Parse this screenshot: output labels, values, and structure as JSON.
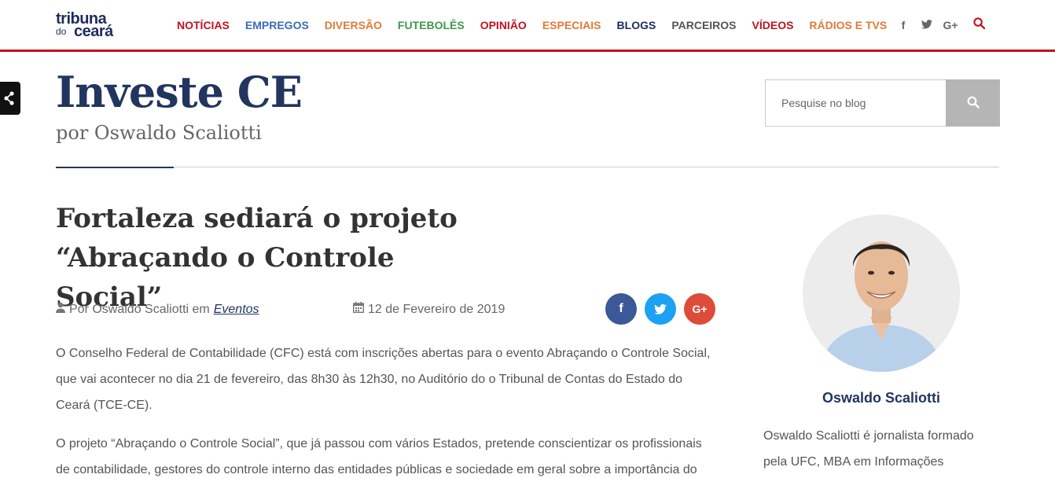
{
  "header": {
    "logo": {
      "line1": "tribuna",
      "line2": "do",
      "line3": "ceará"
    },
    "nav": [
      {
        "label": "NOTÍCIAS",
        "color": "#c1121f"
      },
      {
        "label": "EMPREGOS",
        "color": "#3a6cb5"
      },
      {
        "label": "DIVERSÃO",
        "color": "#e07b39"
      },
      {
        "label": "FUTEBOLÊS",
        "color": "#3c9a4a"
      },
      {
        "label": "OPINIÃO",
        "color": "#c1121f"
      },
      {
        "label": "ESPECIAIS",
        "color": "#e07b39"
      },
      {
        "label": "BLOGS",
        "color": "#1f2d5c"
      },
      {
        "label": "PARCEIROS",
        "color": "#555555"
      },
      {
        "label": "VÍDEOS",
        "color": "#c1121f"
      },
      {
        "label": "RÁDIOS E TVS",
        "color": "#e07b39"
      }
    ],
    "social": {
      "facebook": "f",
      "twitter": "twitter-icon",
      "gplus": "G+"
    }
  },
  "blog": {
    "title": "Investe CE",
    "subtitle": "por Oswaldo Scaliotti",
    "search_placeholder": "Pesquise no blog"
  },
  "post": {
    "title": "Fortaleza sediará o projeto “Abraçando o Controle Social”",
    "author_prefix": "Por Oswaldo Scaliotti em",
    "category": "Eventos",
    "date": "12 de Fevereiro de 2019",
    "share": {
      "facebook": "f",
      "gplus": "G+"
    },
    "paragraphs": [
      "O Conselho Federal de Contabilidade (CFC) está com inscrições abertas para o evento Abraçando o Controle Social, que vai acontecer no dia 21 de fevereiro, das 8h30 às 12h30, no Auditório do o Tribunal de Contas do Estado do Ceará (TCE-CE).",
      "O projeto “Abraçando o Controle Social”, que já passou com vários Estados, pretende conscientizar os profissionais de contabilidade, gestores do controle interno das entidades públicas e sociedade em geral sobre a importância do"
    ]
  },
  "author": {
    "name": "Oswaldo Scaliotti",
    "bio": "Oswaldo Scaliotti é jornalista formado pela UFC, MBA em Informações"
  },
  "colors": {
    "accent": "#c1121f",
    "brand": "#22355f",
    "facebook": "#3b5998",
    "twitter": "#1da1f2",
    "gplus": "#dd4b39"
  }
}
